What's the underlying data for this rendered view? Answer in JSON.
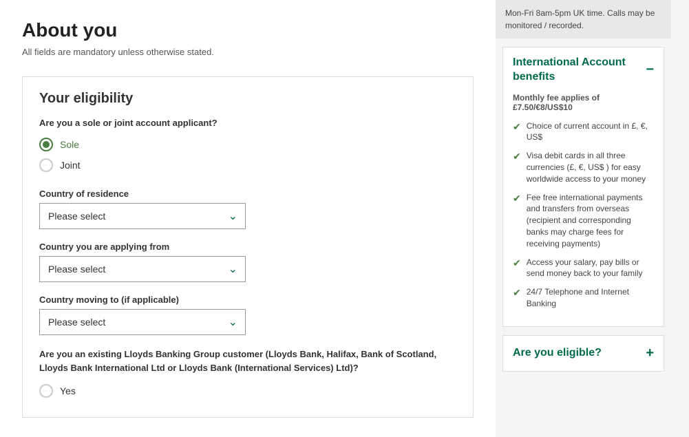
{
  "page": {
    "title": "About you",
    "subtitle": "All fields are mandatory unless otherwise stated."
  },
  "eligibility": {
    "section_title": "Your eligibility",
    "applicant_question": "Are you a sole or joint account applicant?",
    "applicant_options": [
      {
        "value": "sole",
        "label": "Sole",
        "checked": true
      },
      {
        "value": "joint",
        "label": "Joint",
        "checked": false
      }
    ],
    "country_residence_label": "Country of residence",
    "country_residence_placeholder": "Please select",
    "country_applying_label": "Country you are applying from",
    "country_applying_placeholder": "Please select",
    "country_moving_label": "Country moving to (if applicable)",
    "country_moving_placeholder": "Please select",
    "existing_customer_question": "Are you an existing Lloyds Banking Group customer (Lloyds Bank, Halifax, Bank of Scotland, Lloyds Bank International Ltd or Lloyds Bank (International Services) Ltd)?",
    "yes_label": "Yes"
  },
  "sidebar": {
    "contact_text": "Mon-Fri 8am-5pm UK time. Calls may be monitored / recorded.",
    "benefits_title": "International Account benefits",
    "monthly_fee": "Monthly fee applies of £7.50/€8/US$10",
    "benefits": [
      {
        "text": "Choice of current account in £, €, US$"
      },
      {
        "text": "Visa debit cards in all three currencies (£, €, US$ ) for easy worldwide access to your money"
      },
      {
        "text": "Fee free international payments and transfers from overseas (recipient and corresponding banks may charge fees for receiving payments)"
      },
      {
        "text": "Access your salary, pay bills or send money back to your family"
      },
      {
        "text": "24/7 Telephone and Internet Banking"
      }
    ],
    "eligible_title": "Are you eligible?",
    "minus_icon": "−",
    "plus_icon": "+"
  }
}
